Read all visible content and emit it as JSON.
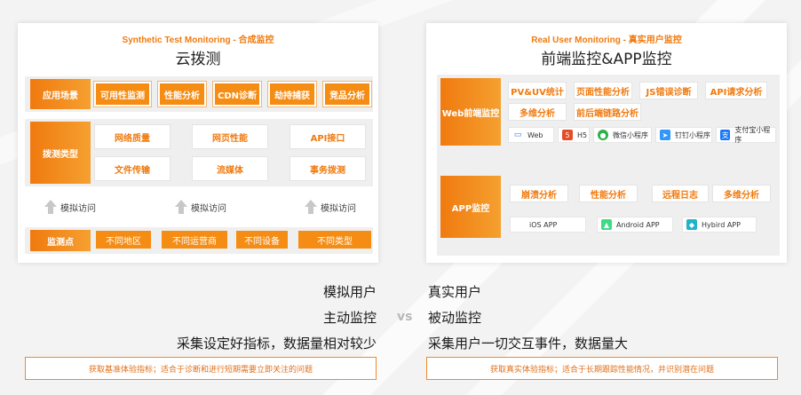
{
  "left": {
    "subtitle": "Synthetic Test Monitoring - 合成监控",
    "title": "云拨测",
    "scenario_label": "应用场景",
    "scenarios": [
      "可用性监测",
      "性能分析",
      "CDN诊断",
      "劫持捕获",
      "竞品分析"
    ],
    "probe_label": "拨测类型",
    "probe_types": [
      "网络质量",
      "网页性能",
      "API接口",
      "文件传输",
      "流媒体",
      "事务拨测"
    ],
    "simulate": [
      "模拟访问",
      "模拟访问",
      "模拟访问"
    ],
    "monitor_label": "监测点",
    "monitor_points": [
      "不同地区",
      "不同运营商",
      "不同设备",
      "不同类型"
    ]
  },
  "right": {
    "subtitle": "Real User Monitoring - 真实用户监控",
    "title": "前端监控&APP监控",
    "web_label": "Web前端监控",
    "web_features": [
      "PV&UV统计",
      "页面性能分析",
      "JS错误诊断",
      "API请求分析",
      "多维分析",
      "前后端链路分析"
    ],
    "web_platforms": [
      {
        "icon": "monitor-icon",
        "label": "Web"
      },
      {
        "icon": "html5-icon",
        "label": "H5"
      },
      {
        "icon": "wechat-icon",
        "label": "微信小程序"
      },
      {
        "icon": "dingtalk-icon",
        "label": "钉钉小程序"
      },
      {
        "icon": "alipay-icon",
        "label": "支付宝小程序"
      }
    ],
    "app_label": "APP监控",
    "app_features": [
      "崩溃分析",
      "性能分析",
      "远程日志",
      "多维分析"
    ],
    "app_platforms": [
      {
        "icon": "apple-icon",
        "label": "iOS APP"
      },
      {
        "icon": "android-icon",
        "label": "Android APP"
      },
      {
        "icon": "hybrid-icon",
        "label": "Hybird APP"
      }
    ]
  },
  "compare": {
    "left": [
      "模拟用户",
      "主动监控",
      "采集设定好指标，数据量相对较少"
    ],
    "right": [
      "真实用户",
      "被动监控",
      "采集用户一切交互事件，数据量大"
    ],
    "vs": "vs",
    "left_note": "获取基准体验指标；适合于诊断和进行短期需要立即关注的问题",
    "right_note": "获取真实体验指标；适合于长期跟踪性能情况，并识别潜在问题"
  },
  "colors": {
    "accent": "#f58c13",
    "accent_dark": "#f07a0f"
  }
}
